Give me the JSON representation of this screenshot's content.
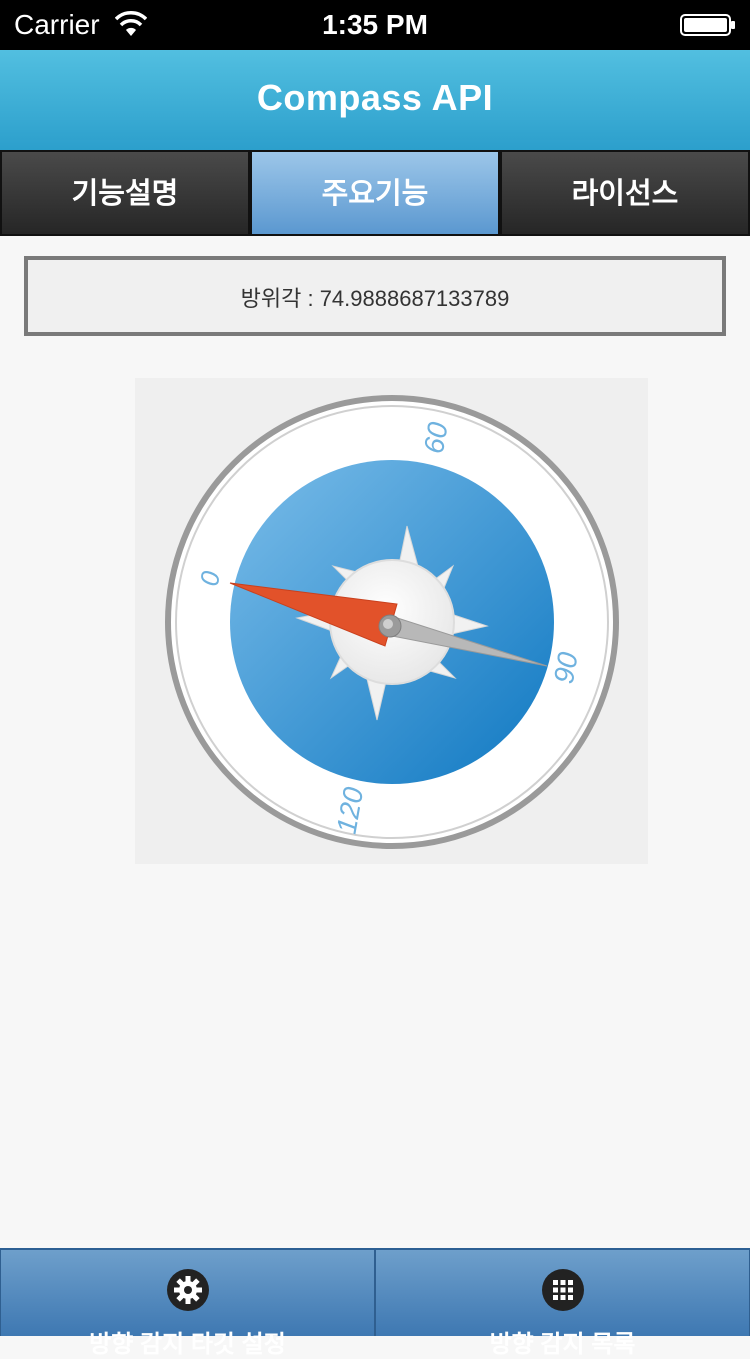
{
  "status_bar": {
    "carrier": "Carrier",
    "time": "1:35 PM"
  },
  "header": {
    "title": "Compass API"
  },
  "tabs": [
    {
      "label": "기능설명",
      "active": false
    },
    {
      "label": "주요기능",
      "active": true
    },
    {
      "label": "라이선스",
      "active": false
    }
  ],
  "heading": {
    "text": "방위각 : 74.9888687133789"
  },
  "compass": {
    "dial_labels": [
      "0",
      "60",
      "90",
      "120"
    ],
    "colors": {
      "dial_blue": "#2a8fd0",
      "needle_red": "#e2522a",
      "needle_gray": "#a8a8a8"
    }
  },
  "tabbar": {
    "items": [
      {
        "icon": "gear-icon",
        "label": "방향 감지 타깃 설정"
      },
      {
        "icon": "grid-icon",
        "label": "방향 감지 목록"
      }
    ]
  }
}
